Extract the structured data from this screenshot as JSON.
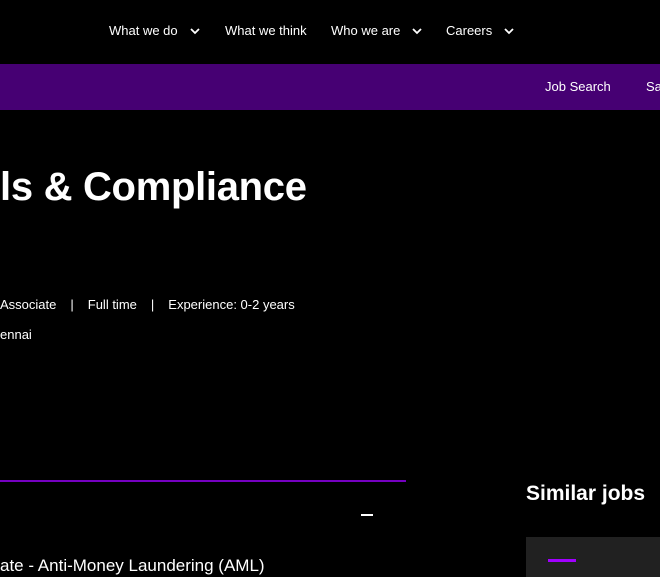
{
  "top_nav": {
    "items": [
      {
        "label": "What we do",
        "has_dropdown": true
      },
      {
        "label": "What we think",
        "has_dropdown": false
      },
      {
        "label": "Who we are",
        "has_dropdown": true
      },
      {
        "label": "Careers",
        "has_dropdown": true
      }
    ]
  },
  "sub_nav": {
    "items": [
      "Job Search",
      "Sa"
    ]
  },
  "job": {
    "title": "ls & Compliance",
    "level": "Associate",
    "separator": "|",
    "type": "Full time",
    "experience": "Experience: 0-2 years",
    "location": "ennai",
    "section_title": "ate - Anti-Money Laundering (AML)"
  },
  "similar_jobs": {
    "heading": "Similar jobs"
  },
  "colors": {
    "purple_bar": "#460073",
    "accent": "#a100ff",
    "rule": "#7500c0"
  },
  "icons": [
    "chevron-down-icon",
    "collapse-icon"
  ]
}
